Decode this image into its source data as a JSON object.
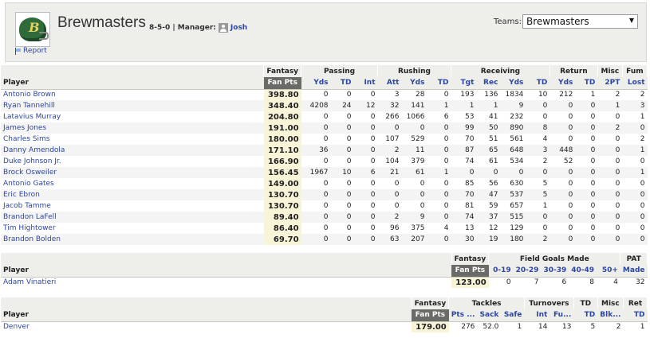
{
  "header": {
    "team_name": "Brewmasters",
    "record": "8-5-0 | Manager:",
    "manager": "Josh",
    "report_link": "Report",
    "teams_label": "Teams:",
    "teams_selected": "Brewmasters",
    "helmet_letter": "B",
    "brand_color": "#2f6a3a"
  },
  "offense": {
    "groups": [
      "Fantasy",
      "Passing",
      "Rushing",
      "Receiving",
      "Return",
      "Misc",
      "Fum"
    ],
    "columns": [
      "Player",
      "Fan Pts",
      "Yds",
      "TD",
      "Int",
      "Att",
      "Yds",
      "TD",
      "Tgt",
      "Rec",
      "Yds",
      "TD",
      "Yds",
      "TD",
      "2PT",
      "Lost"
    ],
    "rows": [
      [
        "Antonio Brown",
        "398.80",
        "0",
        "0",
        "0",
        "3",
        "28",
        "0",
        "193",
        "136",
        "1834",
        "10",
        "212",
        "1",
        "2",
        "2"
      ],
      [
        "Ryan Tannehill",
        "348.40",
        "4208",
        "24",
        "12",
        "32",
        "141",
        "1",
        "1",
        "1",
        "9",
        "0",
        "0",
        "0",
        "1",
        "3"
      ],
      [
        "Latavius Murray",
        "204.80",
        "0",
        "0",
        "0",
        "266",
        "1066",
        "6",
        "53",
        "41",
        "232",
        "0",
        "0",
        "0",
        "0",
        "1"
      ],
      [
        "James Jones",
        "191.00",
        "0",
        "0",
        "0",
        "0",
        "0",
        "0",
        "99",
        "50",
        "890",
        "8",
        "0",
        "0",
        "2",
        "0"
      ],
      [
        "Charles Sims",
        "180.00",
        "0",
        "0",
        "0",
        "107",
        "529",
        "0",
        "70",
        "51",
        "561",
        "4",
        "0",
        "0",
        "0",
        "2"
      ],
      [
        "Danny Amendola",
        "171.10",
        "36",
        "0",
        "0",
        "2",
        "11",
        "0",
        "87",
        "65",
        "648",
        "3",
        "448",
        "0",
        "0",
        "1"
      ],
      [
        "Duke Johnson Jr.",
        "166.90",
        "0",
        "0",
        "0",
        "104",
        "379",
        "0",
        "74",
        "61",
        "534",
        "2",
        "52",
        "0",
        "0",
        "0"
      ],
      [
        "Brock Osweiler",
        "156.45",
        "1967",
        "10",
        "6",
        "21",
        "61",
        "1",
        "0",
        "0",
        "0",
        "0",
        "0",
        "0",
        "0",
        "1"
      ],
      [
        "Antonio Gates",
        "149.00",
        "0",
        "0",
        "0",
        "0",
        "0",
        "0",
        "85",
        "56",
        "630",
        "5",
        "0",
        "0",
        "0",
        "0"
      ],
      [
        "Eric Ebron",
        "130.70",
        "0",
        "0",
        "0",
        "0",
        "0",
        "0",
        "70",
        "47",
        "537",
        "5",
        "0",
        "0",
        "0",
        "0"
      ],
      [
        "Jacob Tamme",
        "130.70",
        "0",
        "0",
        "0",
        "0",
        "0",
        "0",
        "81",
        "59",
        "657",
        "1",
        "0",
        "0",
        "0",
        "0"
      ],
      [
        "Brandon LaFell",
        "89.40",
        "0",
        "0",
        "0",
        "2",
        "9",
        "0",
        "74",
        "37",
        "515",
        "0",
        "0",
        "0",
        "0",
        "0"
      ],
      [
        "Tim Hightower",
        "86.40",
        "0",
        "0",
        "0",
        "96",
        "375",
        "4",
        "13",
        "12",
        "129",
        "0",
        "0",
        "0",
        "0",
        "0"
      ],
      [
        "Brandon Bolden",
        "69.70",
        "0",
        "0",
        "0",
        "63",
        "207",
        "0",
        "30",
        "19",
        "180",
        "2",
        "0",
        "0",
        "0",
        "0"
      ]
    ]
  },
  "kicker": {
    "groups": [
      "Fantasy",
      "Field Goals Made",
      "PAT"
    ],
    "columns": [
      "Player",
      "Fan Pts",
      "0-19",
      "20-29",
      "30-39",
      "40-49",
      "50+",
      "Made"
    ],
    "rows": [
      [
        "Adam Vinatieri",
        "123.00",
        "0",
        "7",
        "6",
        "8",
        "4",
        "32"
      ]
    ]
  },
  "defense": {
    "groups": [
      "Fantasy",
      "Tackles",
      "Turnovers",
      "TD",
      "Misc",
      "Ret"
    ],
    "columns": [
      "Player",
      "Fan Pts",
      "Pts ...",
      "Sack",
      "Safe",
      "Int",
      "Fu...",
      "TD",
      "Blk...",
      "TD"
    ],
    "rows": [
      [
        "Denver",
        "179.00",
        "276",
        "52.0",
        "1",
        "14",
        "13",
        "5",
        "2",
        "1"
      ]
    ]
  }
}
